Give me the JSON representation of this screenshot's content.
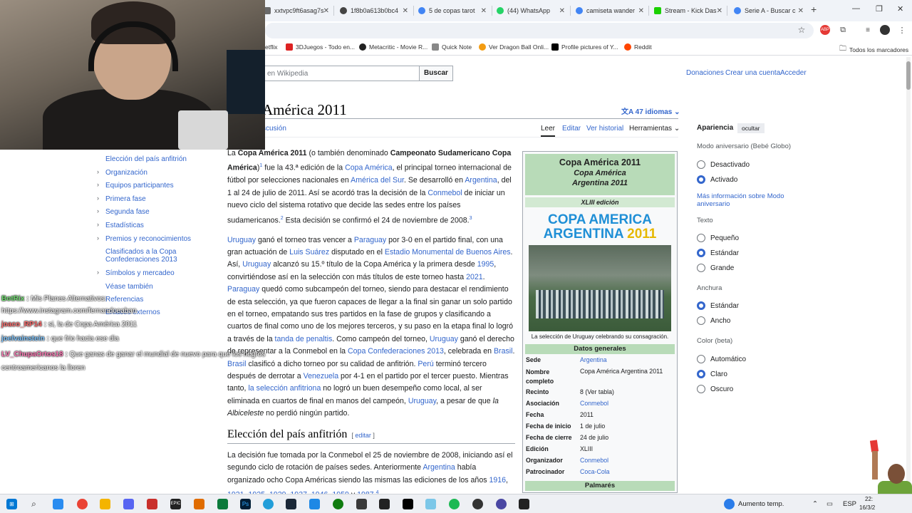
{
  "browser": {
    "tabs": [
      {
        "label": "xxtvpc9ft6asag7s",
        "color": "#6a6a6a"
      },
      {
        "label": "1f8b0a613b0bc4",
        "color": "#444"
      },
      {
        "label": "5 de copas tarot",
        "color": "#4285f4"
      },
      {
        "label": "(44) WhatsApp",
        "color": "#25d366"
      },
      {
        "label": "camiseta wander",
        "color": "#4285f4"
      },
      {
        "label": "Stream - Kick Das",
        "color": "#1ad000"
      },
      {
        "label": "Serie A - Buscar c",
        "color": "#4285f4"
      }
    ],
    "bookmarks": [
      {
        "label": "etflix",
        "color": "#e50914"
      },
      {
        "label": "3DJuegos - Todo en...",
        "color": "#d22"
      },
      {
        "label": "Metacritic - Movie R...",
        "color": "#222"
      },
      {
        "label": "Quick Note",
        "color": "#555"
      },
      {
        "label": "Ver Dragon Ball Onli...",
        "color": "#f39c12"
      },
      {
        "label": "Profile pictures of Y...",
        "color": "#000"
      },
      {
        "label": "Reddit",
        "color": "#ff4500"
      }
    ],
    "all_bookmarks": "Todos los marcadores"
  },
  "wiki": {
    "search_placeholder": "en Wikipedia",
    "search_button": "Buscar",
    "top_links": [
      "Donaciones",
      "Crear una cuenta",
      "Acceder"
    ],
    "title": "América 2011",
    "languages": "47 idiomas",
    "tab_discussion": "scusión",
    "view_tabs": [
      "Leer",
      "Editar",
      "Ver historial",
      "Herramientas"
    ],
    "toc": [
      {
        "label": "Elección del país anfitrión",
        "chevron": false
      },
      {
        "label": "Organización",
        "chevron": true
      },
      {
        "label": "Equipos participantes",
        "chevron": true
      },
      {
        "label": "Primera fase",
        "chevron": true
      },
      {
        "label": "Segunda fase",
        "chevron": true
      },
      {
        "label": "Estadísticas",
        "chevron": true
      },
      {
        "label": "Premios y reconocimientos",
        "chevron": true
      },
      {
        "label": "Clasificados a la Copa Confederaciones 2013",
        "chevron": false
      },
      {
        "label": "Símbolos y mercadeo",
        "chevron": true
      },
      {
        "label": "Véase también",
        "chevron": false
      },
      {
        "label": "Referencias",
        "chevron": false
      },
      {
        "label": "Enlaces externos",
        "chevron": false
      }
    ],
    "section_heading": "Elección del país anfitrión",
    "section_edit": "editar"
  },
  "infobox": {
    "title": "Copa América 2011",
    "subtitle1": "Copa América",
    "subtitle2": "Argentina 2011",
    "edition": "XLIII edición",
    "logo_line1": "COPA AMERICA",
    "logo_line2": "ARGENTINA",
    "logo_year": "2011",
    "caption": "La selección de Uruguay celebrando su consagración.",
    "section_general": "Datos generales",
    "rows": [
      {
        "k": "Sede",
        "v": "Argentina",
        "link": true
      },
      {
        "k": "Nombre completo",
        "v": "Copa América Argentina 2011",
        "link": false
      },
      {
        "k": "Recinto",
        "v": "8 (Ver tabla)",
        "link": false
      },
      {
        "k": "Asociación",
        "v": "Conmebol",
        "link": true
      },
      {
        "k": "Fecha",
        "v": "2011",
        "link": false
      },
      {
        "k": "Fecha de inicio",
        "v": "1 de julio",
        "link": false
      },
      {
        "k": "Fecha de cierre",
        "v": "24 de julio",
        "link": false
      },
      {
        "k": "Edición",
        "v": "XLIII",
        "link": false
      },
      {
        "k": "Organizador",
        "v": "Conmebol",
        "link": true
      },
      {
        "k": "Patrocinador",
        "v": "Coca-Cola",
        "link": true
      }
    ],
    "section_palmares": "Palmarés"
  },
  "appearance": {
    "title": "Apariencia",
    "hide": "ocultar",
    "anniversary_label": "Modo aniversario (Bebé Globo)",
    "anniversary_options": [
      "Desactivado",
      "Activado"
    ],
    "anniversary_selected": 1,
    "anniversary_more": "Más información sobre Modo aniversario",
    "text_label": "Texto",
    "text_options": [
      "Pequeño",
      "Estándar",
      "Grande"
    ],
    "text_selected": 1,
    "width_label": "Anchura",
    "width_options": [
      "Estándar",
      "Ancho"
    ],
    "width_selected": 0,
    "color_label": "Color (beta)",
    "color_options": [
      "Automático",
      "Claro",
      "Oscuro"
    ],
    "color_selected": 1
  },
  "chat": [
    {
      "user": "BotRix",
      "msg": "Mis Planes Alternativos:",
      "color": "#6fdc6f"
    },
    {
      "user": "",
      "msg": "https://www.instagram.com/fernandoeaban",
      "color": "#fff"
    },
    {
      "user": "joaco_RP14",
      "msg": "si, la de Copa América 2011",
      "color": "#ff6b6b"
    },
    {
      "user": "joelvainstein",
      "msg": "que frio hacia ese dia",
      "color": "#7fc6ff"
    },
    {
      "user": "LV_ChupaOrtos18",
      "msg": "Que ganas de ganar el mundial de nuevo para que los negros",
      "color": "#ff7ab6"
    },
    {
      "user": "",
      "msg": "centroamericanos la lloren",
      "color": "#fff"
    }
  ],
  "taskbar": {
    "weather": "Aumento temp.",
    "lang": "ESP",
    "time": "22:",
    "date": "16/3/2"
  }
}
